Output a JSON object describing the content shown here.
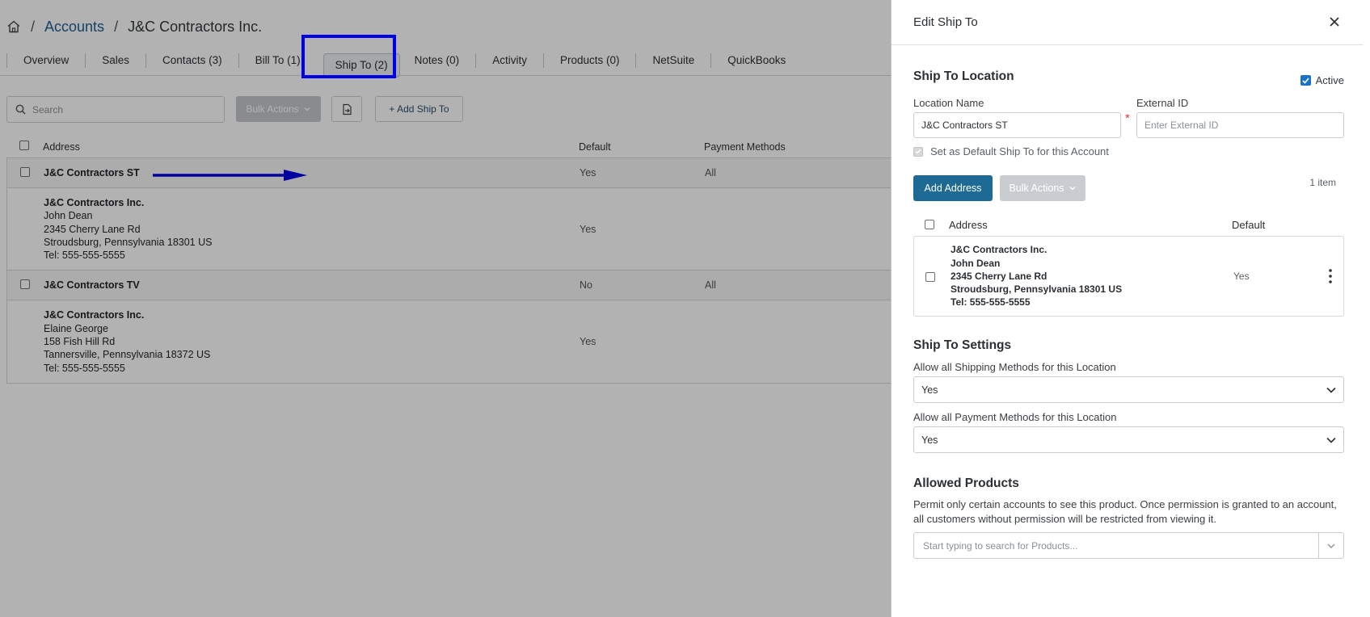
{
  "breadcrumb": {
    "separator": "/",
    "accounts": "Accounts",
    "current": "J&C Contractors Inc."
  },
  "tabs": [
    {
      "label": "Overview"
    },
    {
      "label": "Sales"
    },
    {
      "label": "Contacts (3)"
    },
    {
      "label": "Bill To (1)"
    },
    {
      "label": "Ship To (2)"
    },
    {
      "label": "Notes (0)"
    },
    {
      "label": "Activity"
    },
    {
      "label": "Products (0)"
    },
    {
      "label": "NetSuite"
    },
    {
      "label": "QuickBooks"
    }
  ],
  "active_tab": "Ship To (2)",
  "toolbar": {
    "search_placeholder": "Search",
    "bulk_actions": "Bulk Actions",
    "add_ship_to": "+ Add Ship To"
  },
  "table": {
    "headers": {
      "address": "Address",
      "default": "Default",
      "payment": "Payment Methods"
    },
    "groups": [
      {
        "name": "J&C Contractors ST",
        "default": "Yes",
        "payment": "All",
        "address": {
          "lines": [
            "J&C Contractors Inc.",
            "John Dean",
            "2345 Cherry Lane Rd",
            "Stroudsburg, Pennsylvania 18301 US",
            "Tel: 555-555-5555"
          ],
          "default": "Yes"
        }
      },
      {
        "name": "J&C Contractors TV",
        "default": "No",
        "payment": "All",
        "address": {
          "lines": [
            "J&C Contractors Inc.",
            "Elaine George",
            "158 Fish Hill Rd",
            "Tannersville, Pennsylvania 18372 US",
            "Tel: 555-555-5555"
          ],
          "default": "Yes"
        }
      }
    ]
  },
  "panel": {
    "title": "Edit Ship To",
    "section_location": "Ship To Location",
    "active_label": "Active",
    "location_name_label": "Location Name",
    "location_name_value": "J&C Contractors ST",
    "required_mark": "*",
    "external_id_label": "External ID",
    "external_id_placeholder": "Enter External ID",
    "default_checkbox_label": "Set as Default Ship To for this Account",
    "add_address": "Add Address",
    "bulk_actions": "Bulk Actions",
    "item_count": "1 item",
    "addr_headers": {
      "address": "Address",
      "default": "Default"
    },
    "address": {
      "lines": [
        "J&C Contractors Inc.",
        "John Dean",
        "2345 Cherry Lane Rd",
        "Stroudsburg, Pennsylvania 18301 US",
        "Tel: 555-555-5555"
      ],
      "default": "Yes"
    },
    "section_settings": "Ship To Settings",
    "shipping_label": "Allow all Shipping Methods for this Location",
    "shipping_value": "Yes",
    "payment_label": "Allow all Payment Methods for this Location",
    "payment_value": "Yes",
    "section_products": "Allowed Products",
    "products_desc": "Permit only certain accounts to see this product. Once permission is granted to an account, all customers without permission will be restricted from viewing it.",
    "products_placeholder": "Start typing to search for Products..."
  },
  "colors": {
    "primary": "#1d6a94",
    "checkbox": "#1a73c9",
    "highlight": "#0000e6",
    "link": "#1f5d94"
  }
}
